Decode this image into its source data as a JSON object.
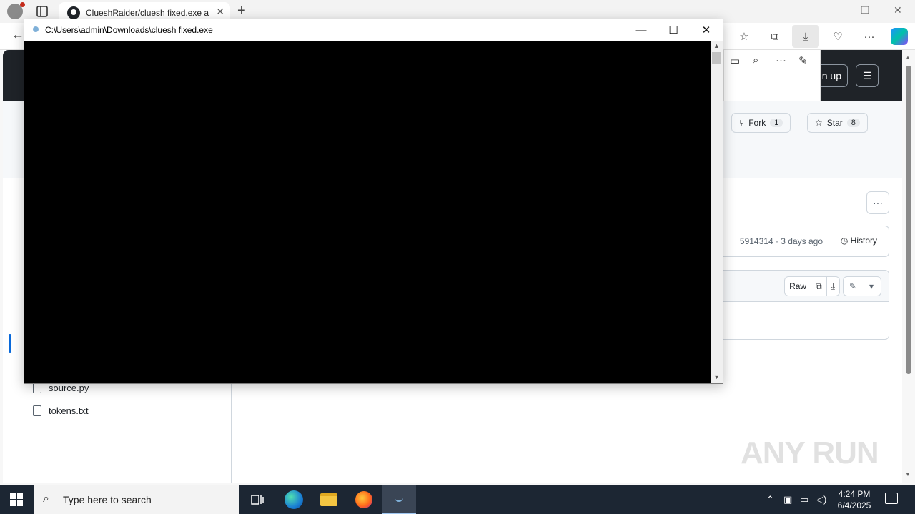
{
  "browser": {
    "tab_title": "ClueshRaider/cluesh fixed.exe at",
    "tab_close": "✕",
    "new_tab": "+",
    "minimize": "—",
    "restore": "❐",
    "close": "✕"
  },
  "page": {
    "signup_label": "n up",
    "fork_label": "Fork",
    "fork_count": "1",
    "star_label": "Star",
    "star_count": "8",
    "more_label": "···",
    "commit_meta": "5914314 · 3 days ago",
    "history_label": "History",
    "raw_label": "Raw",
    "files": [
      "source.py",
      "tokens.txt"
    ]
  },
  "console": {
    "title": "C:\\Users\\admin\\Downloads\\cluesh fixed.exe",
    "minimize": "—",
    "maximize": "☐",
    "close": "✕"
  },
  "taskbar": {
    "search_placeholder": "Type here to search",
    "time": "4:24 PM",
    "date": "6/4/2025"
  },
  "watermark": "ANY RUN"
}
